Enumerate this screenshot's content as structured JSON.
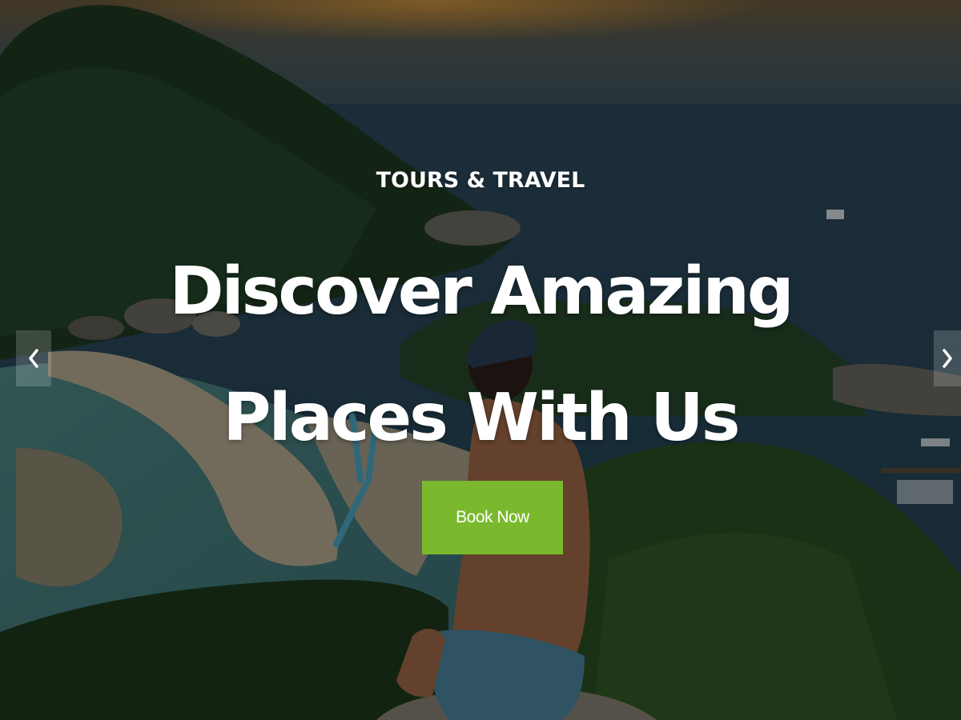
{
  "hero": {
    "eyebrow": "TOURS & TRAVEL",
    "headline": "Discover Amazing Places With Us",
    "button_label": "Book Now",
    "button_color": "#7ab92d"
  },
  "slider": {
    "prev_icon": "chevron-left-icon",
    "next_icon": "chevron-right-icon"
  }
}
